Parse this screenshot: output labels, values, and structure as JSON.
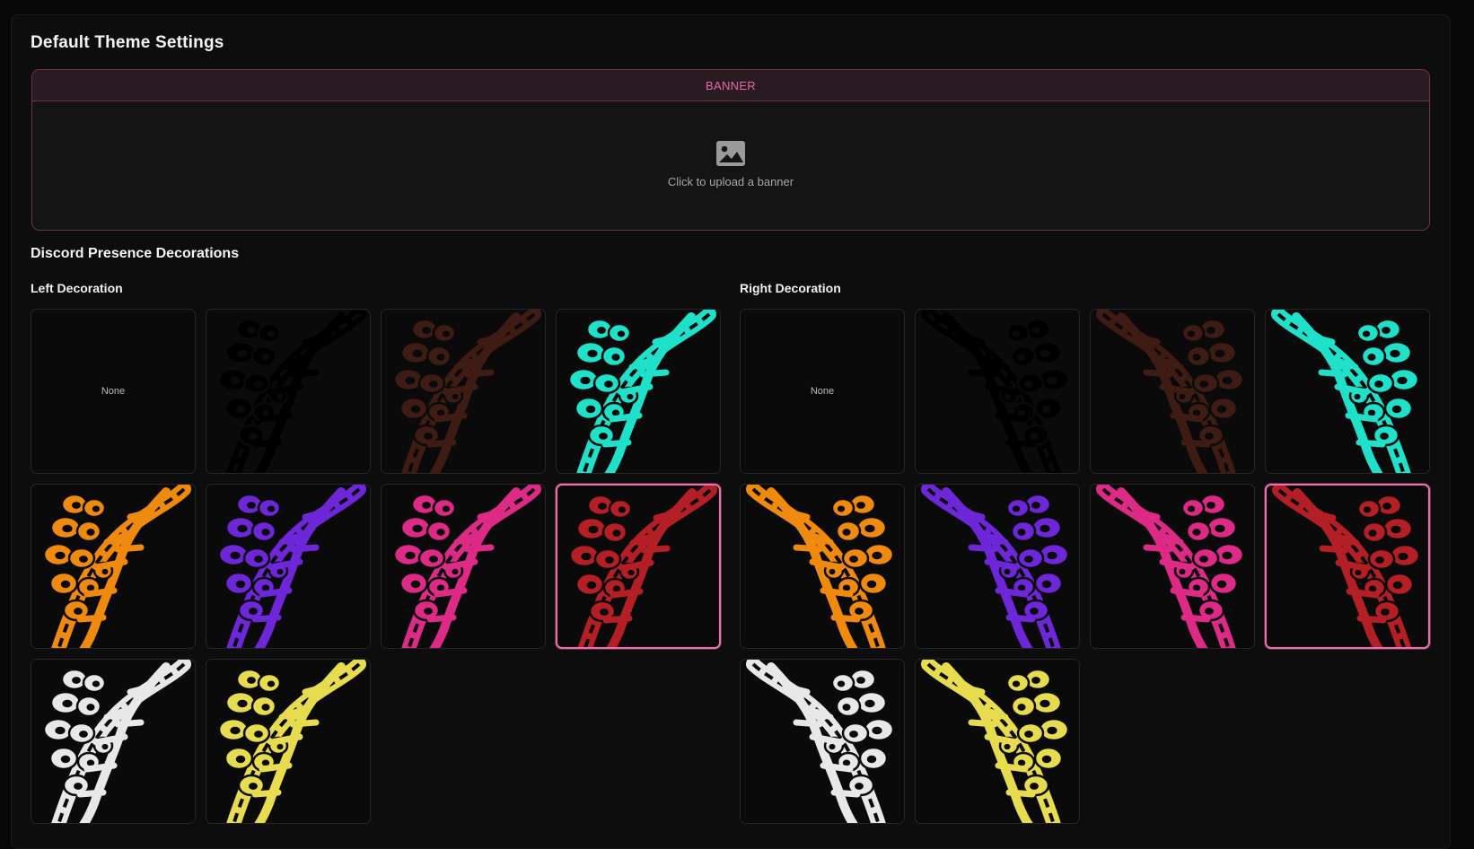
{
  "page": {
    "title": "Default Theme Settings",
    "accent_color": "#e56aa8"
  },
  "banner": {
    "header_label": "BANNER",
    "upload_text": "Click to upload a banner",
    "icon": "image-icon"
  },
  "decorations": {
    "section_title": "Discord Presence Decorations",
    "left": {
      "label": "Left Decoration",
      "selected": "red",
      "options": [
        {
          "id": "none",
          "label": "None"
        },
        {
          "id": "black",
          "color": "#000000"
        },
        {
          "id": "brown",
          "color": "#3e1c14"
        },
        {
          "id": "teal",
          "color": "#1fe0c8"
        },
        {
          "id": "orange",
          "color": "#f08a0f"
        },
        {
          "id": "purple",
          "color": "#6d26d8"
        },
        {
          "id": "pink",
          "color": "#dc2a86"
        },
        {
          "id": "red",
          "color": "#b31f24"
        },
        {
          "id": "white",
          "color": "#e8e8e8"
        },
        {
          "id": "yellow",
          "color": "#e7dc50"
        }
      ]
    },
    "right": {
      "label": "Right Decoration",
      "selected": "red",
      "options": [
        {
          "id": "none",
          "label": "None"
        },
        {
          "id": "black",
          "color": "#000000"
        },
        {
          "id": "brown",
          "color": "#3e1c14"
        },
        {
          "id": "teal",
          "color": "#1fe0c8"
        },
        {
          "id": "orange",
          "color": "#f08a0f"
        },
        {
          "id": "purple",
          "color": "#6d26d8"
        },
        {
          "id": "pink",
          "color": "#dc2a86"
        },
        {
          "id": "red",
          "color": "#b31f24"
        },
        {
          "id": "white",
          "color": "#e8e8e8"
        },
        {
          "id": "yellow",
          "color": "#e7dc50"
        }
      ]
    }
  }
}
